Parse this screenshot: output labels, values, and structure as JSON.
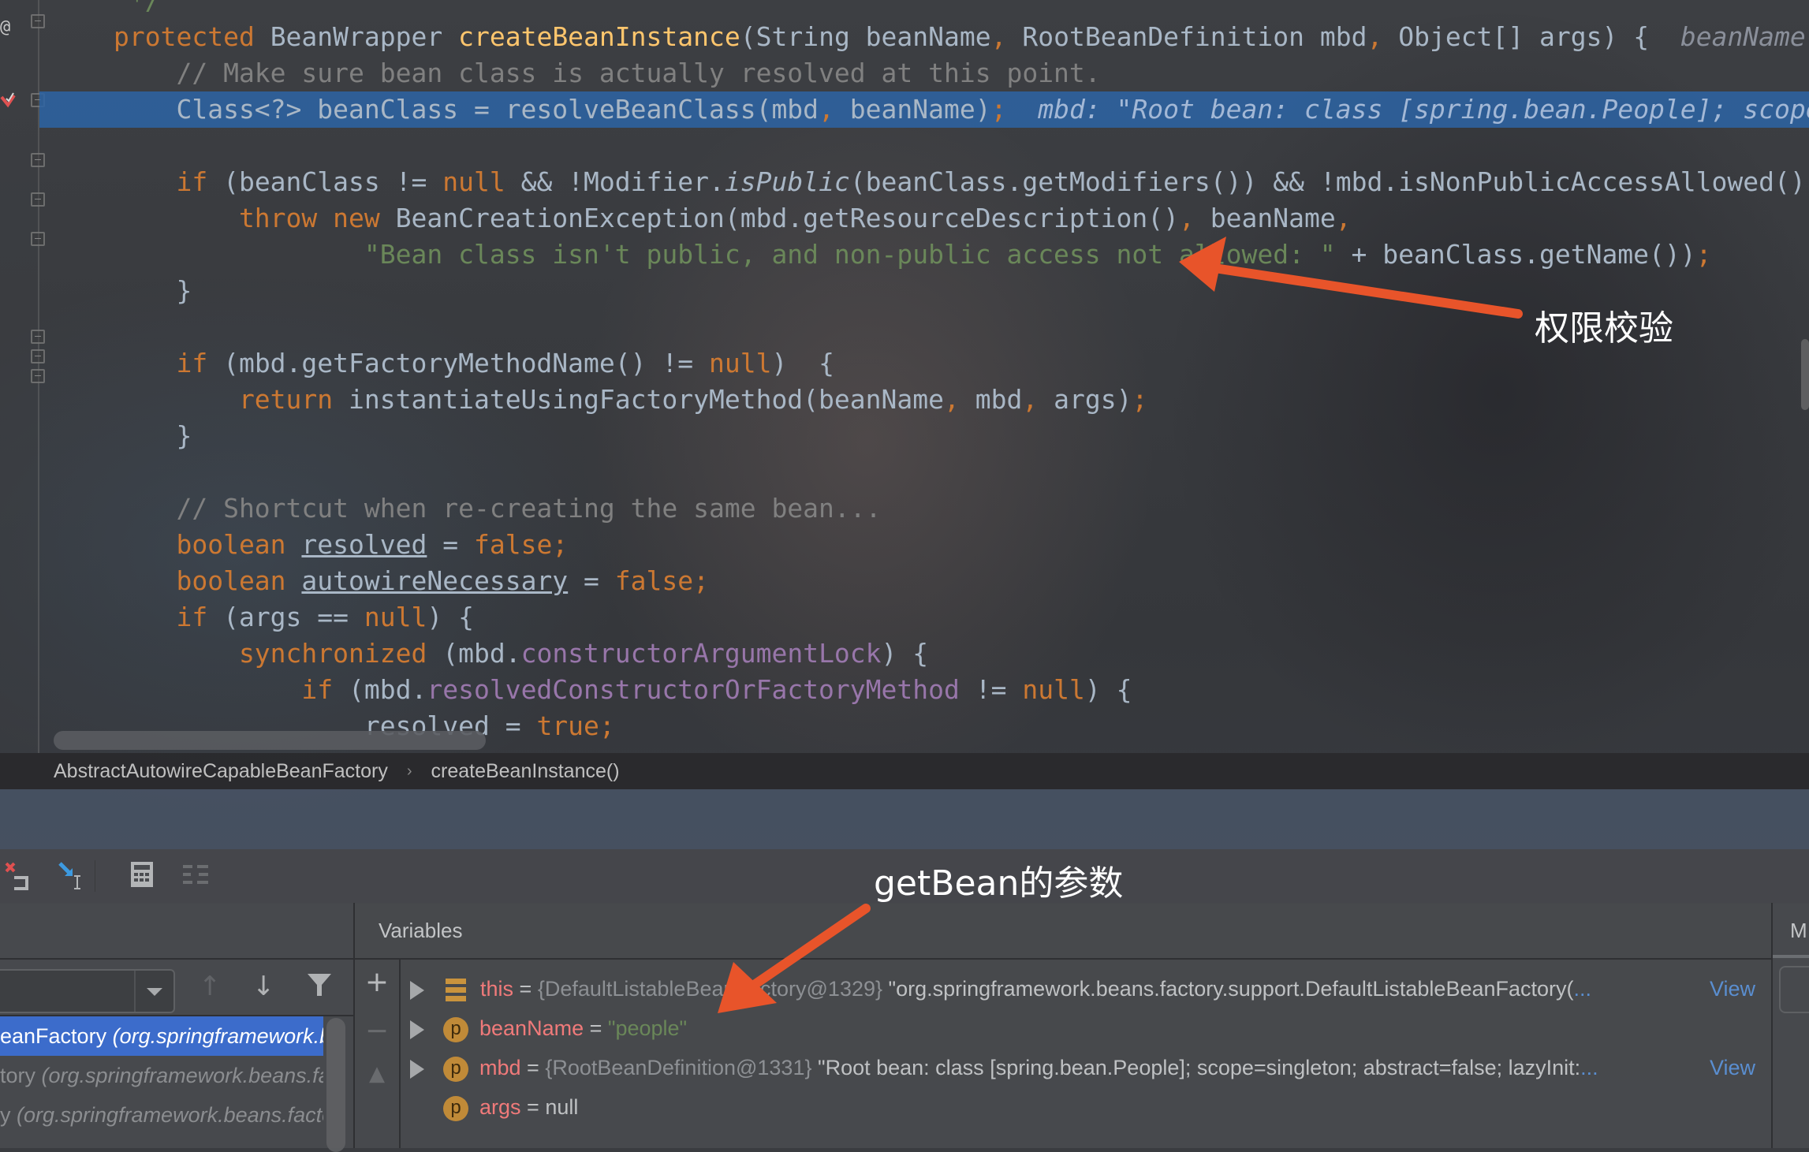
{
  "editor": {
    "gutter_marker": "@",
    "code_lines": [
      {
        "id": "comment-end",
        "segments": [
          {
            "t": " */",
            "c": "str"
          }
        ]
      },
      {
        "id": "method-signature",
        "segments": [
          {
            "t": "protected ",
            "c": "kw"
          },
          {
            "t": "BeanWrapper ",
            "c": "type"
          },
          {
            "t": "createBeanInstance",
            "c": "fn"
          },
          {
            "t": "(String beanName",
            "c": "type"
          },
          {
            "t": ", ",
            "c": "kw"
          },
          {
            "t": "RootBeanDefinition mbd",
            "c": "type"
          },
          {
            "t": ", ",
            "c": "kw"
          },
          {
            "t": "Object[] args) {  ",
            "c": "type"
          },
          {
            "t": "beanName: \"people\"",
            "c": "hint"
          }
        ]
      },
      {
        "id": "comment-make-sure",
        "segments": [
          {
            "t": "    // Make sure bean class is actually resolved at this point.",
            "c": "cm"
          }
        ]
      },
      {
        "id": "resolve-bean-class",
        "exec": true,
        "segments": [
          {
            "t": "    Class<?> beanClass = resolveBeanClass(mbd",
            "c": "type"
          },
          {
            "t": ", ",
            "c": "kw"
          },
          {
            "t": "beanName)",
            "c": "type"
          },
          {
            "t": ";  ",
            "c": "kw"
          },
          {
            "t": "mbd: \"Root bean: class [spring.bean.People]; scope=singleton",
            "c": "hint"
          }
        ]
      },
      {
        "id": "blank-1",
        "segments": []
      },
      {
        "id": "if-public-check",
        "segments": [
          {
            "t": "    if ",
            "c": "kw"
          },
          {
            "t": "(beanClass != ",
            "c": "type"
          },
          {
            "t": "null ",
            "c": "kw"
          },
          {
            "t": "&& !Modifier.",
            "c": "type"
          },
          {
            "t": "isPublic",
            "c": "type it"
          },
          {
            "t": "(beanClass.getModifiers()) && !mbd.isNonPublicAccessAllowed()) {",
            "c": "type"
          }
        ]
      },
      {
        "id": "throw-line",
        "segments": [
          {
            "t": "        throw new ",
            "c": "kw"
          },
          {
            "t": "BeanCreationException(mbd.getResourceDescription()",
            "c": "type"
          },
          {
            "t": ", ",
            "c": "kw"
          },
          {
            "t": "beanName",
            "c": "type"
          },
          {
            "t": ",",
            "c": "kw"
          }
        ]
      },
      {
        "id": "error-message",
        "segments": [
          {
            "t": "                \"Bean class isn't public, and non-public access not allowed: \"",
            "c": "str"
          },
          {
            "t": " + beanClass.getName())",
            "c": "type"
          },
          {
            "t": ";",
            "c": "kw"
          }
        ]
      },
      {
        "id": "close-1",
        "segments": [
          {
            "t": "    }",
            "c": "type"
          }
        ]
      },
      {
        "id": "blank-2",
        "segments": []
      },
      {
        "id": "if-factory-method",
        "segments": [
          {
            "t": "    if ",
            "c": "kw"
          },
          {
            "t": "(mbd.getFactoryMethodName() != ",
            "c": "type"
          },
          {
            "t": "null",
            "c": "kw"
          },
          {
            "t": ")  {",
            "c": "type"
          }
        ]
      },
      {
        "id": "return-factory",
        "segments": [
          {
            "t": "        return ",
            "c": "kw"
          },
          {
            "t": "instantiateUsingFactoryMethod(beanName",
            "c": "type"
          },
          {
            "t": ", ",
            "c": "kw"
          },
          {
            "t": "mbd",
            "c": "type"
          },
          {
            "t": ", ",
            "c": "kw"
          },
          {
            "t": "args)",
            "c": "type"
          },
          {
            "t": ";",
            "c": "kw"
          }
        ]
      },
      {
        "id": "close-2",
        "segments": [
          {
            "t": "    }",
            "c": "type"
          }
        ]
      },
      {
        "id": "blank-3",
        "segments": []
      },
      {
        "id": "comment-shortcut",
        "segments": [
          {
            "t": "    // Shortcut when re-creating the same bean...",
            "c": "cm"
          }
        ]
      },
      {
        "id": "bool-resolved",
        "segments": [
          {
            "t": "    boolean ",
            "c": "kw"
          },
          {
            "t": "resolved",
            "c": "type ul"
          },
          {
            "t": " = ",
            "c": "type"
          },
          {
            "t": "false;",
            "c": "kw"
          }
        ]
      },
      {
        "id": "bool-autowire",
        "segments": [
          {
            "t": "    boolean ",
            "c": "kw"
          },
          {
            "t": "autowireNecessary",
            "c": "type ul"
          },
          {
            "t": " = ",
            "c": "type"
          },
          {
            "t": "false;",
            "c": "kw"
          }
        ]
      },
      {
        "id": "if-args-null",
        "segments": [
          {
            "t": "    if ",
            "c": "kw"
          },
          {
            "t": "(args == ",
            "c": "type"
          },
          {
            "t": "null",
            "c": "kw"
          },
          {
            "t": ") {",
            "c": "type"
          }
        ]
      },
      {
        "id": "synchronized",
        "segments": [
          {
            "t": "        synchronized ",
            "c": "kw"
          },
          {
            "t": "(mbd.",
            "c": "type"
          },
          {
            "t": "constructorArgumentLock",
            "c": "fld"
          },
          {
            "t": ") {",
            "c": "type"
          }
        ]
      },
      {
        "id": "if-resolved-ctor",
        "segments": [
          {
            "t": "            if ",
            "c": "kw"
          },
          {
            "t": "(mbd.",
            "c": "type"
          },
          {
            "t": "resolvedConstructorOrFactoryMethod",
            "c": "fld"
          },
          {
            "t": " != ",
            "c": "type"
          },
          {
            "t": "null",
            "c": "kw"
          },
          {
            "t": ") {",
            "c": "type"
          }
        ]
      },
      {
        "id": "resolved-true",
        "segments": [
          {
            "t": "                resolved",
            "c": "type"
          },
          {
            "t": " = ",
            "c": "type"
          },
          {
            "t": "true;",
            "c": "kw"
          }
        ]
      }
    ]
  },
  "breadcrumb": {
    "items": [
      "AbstractAutowireCapableBeanFactory",
      "createBeanInstance()"
    ],
    "separator": "›"
  },
  "debug_toolbar": {
    "icons": [
      "drop-frame-icon",
      "force-step-into-icon",
      "evaluate-expression-icon",
      "trace-current-stream-icon"
    ]
  },
  "frames": {
    "header": "",
    "thread_selector_value": "",
    "items": [
      {
        "method": "eanFactory",
        "package": " (org.springframework.beans.factory.support)",
        "selected": true
      },
      {
        "method": "tory",
        "package": " (org.springframework.beans.factory.support)",
        "selected": false
      },
      {
        "method": "y",
        "package": " (org.springframework.beans.factory.support)",
        "selected": false
      }
    ]
  },
  "variables": {
    "header": "Variables",
    "rows": [
      {
        "expandable": true,
        "badge": "field-stack",
        "name": "this",
        "type": "{DefaultListableBeanFactory@1329}",
        "value": " \"org.springframework.beans.factory.support.DefaultListableBeanFactory(",
        "ellipsis": "...",
        "view": "View"
      },
      {
        "expandable": true,
        "badge": "p",
        "name": "beanName",
        "type": "",
        "value": "\"people\"",
        "value_is_string": true,
        "ellipsis": "",
        "view": ""
      },
      {
        "expandable": true,
        "badge": "p",
        "name": "mbd",
        "type": "{RootBeanDefinition@1331}",
        "value": " \"Root bean: class [spring.bean.People]; scope=singleton; abstract=false; lazyInit:",
        "ellipsis": "...",
        "view": "View"
      },
      {
        "expandable": false,
        "badge": "p",
        "name": "args",
        "type": "",
        "value": "null",
        "ellipsis": "",
        "view": ""
      }
    ]
  },
  "right_panel": {
    "title": "M"
  },
  "annotations": {
    "permission_check": "权限校验",
    "getbean_params": "getBean的参数",
    "arrow_color": "#e8542a"
  }
}
